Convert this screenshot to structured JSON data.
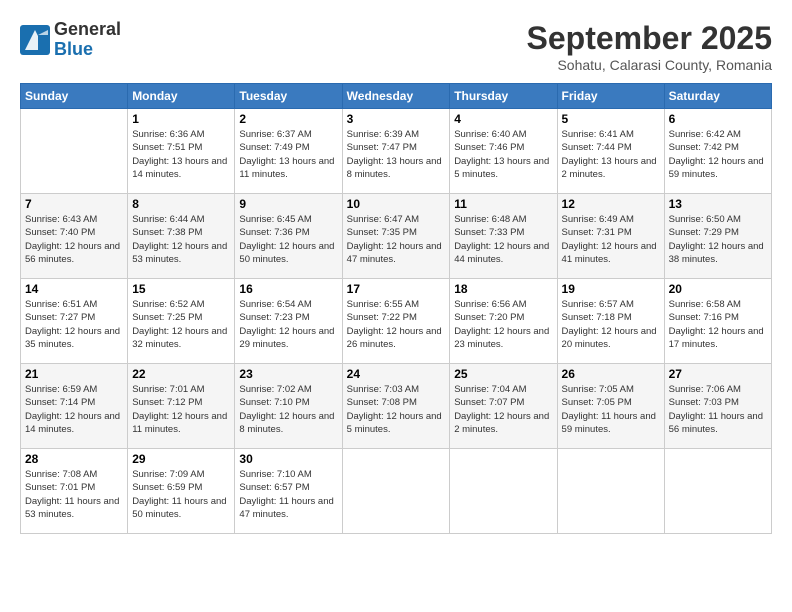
{
  "header": {
    "logo_general": "General",
    "logo_blue": "Blue",
    "month_title": "September 2025",
    "location": "Sohatu, Calarasi County, Romania"
  },
  "days_of_week": [
    "Sunday",
    "Monday",
    "Tuesday",
    "Wednesday",
    "Thursday",
    "Friday",
    "Saturday"
  ],
  "weeks": [
    [
      {
        "day": "",
        "info": ""
      },
      {
        "day": "1",
        "info": "Sunrise: 6:36 AM\nSunset: 7:51 PM\nDaylight: 13 hours\nand 14 minutes."
      },
      {
        "day": "2",
        "info": "Sunrise: 6:37 AM\nSunset: 7:49 PM\nDaylight: 13 hours\nand 11 minutes."
      },
      {
        "day": "3",
        "info": "Sunrise: 6:39 AM\nSunset: 7:47 PM\nDaylight: 13 hours\nand 8 minutes."
      },
      {
        "day": "4",
        "info": "Sunrise: 6:40 AM\nSunset: 7:46 PM\nDaylight: 13 hours\nand 5 minutes."
      },
      {
        "day": "5",
        "info": "Sunrise: 6:41 AM\nSunset: 7:44 PM\nDaylight: 13 hours\nand 2 minutes."
      },
      {
        "day": "6",
        "info": "Sunrise: 6:42 AM\nSunset: 7:42 PM\nDaylight: 12 hours\nand 59 minutes."
      }
    ],
    [
      {
        "day": "7",
        "info": "Sunrise: 6:43 AM\nSunset: 7:40 PM\nDaylight: 12 hours\nand 56 minutes."
      },
      {
        "day": "8",
        "info": "Sunrise: 6:44 AM\nSunset: 7:38 PM\nDaylight: 12 hours\nand 53 minutes."
      },
      {
        "day": "9",
        "info": "Sunrise: 6:45 AM\nSunset: 7:36 PM\nDaylight: 12 hours\nand 50 minutes."
      },
      {
        "day": "10",
        "info": "Sunrise: 6:47 AM\nSunset: 7:35 PM\nDaylight: 12 hours\nand 47 minutes."
      },
      {
        "day": "11",
        "info": "Sunrise: 6:48 AM\nSunset: 7:33 PM\nDaylight: 12 hours\nand 44 minutes."
      },
      {
        "day": "12",
        "info": "Sunrise: 6:49 AM\nSunset: 7:31 PM\nDaylight: 12 hours\nand 41 minutes."
      },
      {
        "day": "13",
        "info": "Sunrise: 6:50 AM\nSunset: 7:29 PM\nDaylight: 12 hours\nand 38 minutes."
      }
    ],
    [
      {
        "day": "14",
        "info": "Sunrise: 6:51 AM\nSunset: 7:27 PM\nDaylight: 12 hours\nand 35 minutes."
      },
      {
        "day": "15",
        "info": "Sunrise: 6:52 AM\nSunset: 7:25 PM\nDaylight: 12 hours\nand 32 minutes."
      },
      {
        "day": "16",
        "info": "Sunrise: 6:54 AM\nSunset: 7:23 PM\nDaylight: 12 hours\nand 29 minutes."
      },
      {
        "day": "17",
        "info": "Sunrise: 6:55 AM\nSunset: 7:22 PM\nDaylight: 12 hours\nand 26 minutes."
      },
      {
        "day": "18",
        "info": "Sunrise: 6:56 AM\nSunset: 7:20 PM\nDaylight: 12 hours\nand 23 minutes."
      },
      {
        "day": "19",
        "info": "Sunrise: 6:57 AM\nSunset: 7:18 PM\nDaylight: 12 hours\nand 20 minutes."
      },
      {
        "day": "20",
        "info": "Sunrise: 6:58 AM\nSunset: 7:16 PM\nDaylight: 12 hours\nand 17 minutes."
      }
    ],
    [
      {
        "day": "21",
        "info": "Sunrise: 6:59 AM\nSunset: 7:14 PM\nDaylight: 12 hours\nand 14 minutes."
      },
      {
        "day": "22",
        "info": "Sunrise: 7:01 AM\nSunset: 7:12 PM\nDaylight: 12 hours\nand 11 minutes."
      },
      {
        "day": "23",
        "info": "Sunrise: 7:02 AM\nSunset: 7:10 PM\nDaylight: 12 hours\nand 8 minutes."
      },
      {
        "day": "24",
        "info": "Sunrise: 7:03 AM\nSunset: 7:08 PM\nDaylight: 12 hours\nand 5 minutes."
      },
      {
        "day": "25",
        "info": "Sunrise: 7:04 AM\nSunset: 7:07 PM\nDaylight: 12 hours\nand 2 minutes."
      },
      {
        "day": "26",
        "info": "Sunrise: 7:05 AM\nSunset: 7:05 PM\nDaylight: 11 hours\nand 59 minutes."
      },
      {
        "day": "27",
        "info": "Sunrise: 7:06 AM\nSunset: 7:03 PM\nDaylight: 11 hours\nand 56 minutes."
      }
    ],
    [
      {
        "day": "28",
        "info": "Sunrise: 7:08 AM\nSunset: 7:01 PM\nDaylight: 11 hours\nand 53 minutes."
      },
      {
        "day": "29",
        "info": "Sunrise: 7:09 AM\nSunset: 6:59 PM\nDaylight: 11 hours\nand 50 minutes."
      },
      {
        "day": "30",
        "info": "Sunrise: 7:10 AM\nSunset: 6:57 PM\nDaylight: 11 hours\nand 47 minutes."
      },
      {
        "day": "",
        "info": ""
      },
      {
        "day": "",
        "info": ""
      },
      {
        "day": "",
        "info": ""
      },
      {
        "day": "",
        "info": ""
      }
    ]
  ]
}
